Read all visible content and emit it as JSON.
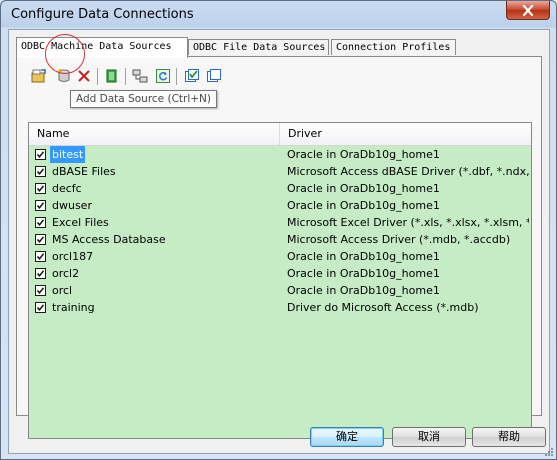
{
  "window": {
    "title": "Configure Data Connections"
  },
  "tabs": [
    {
      "label": "ODBC Machine Data Sources",
      "active": true
    },
    {
      "label": "ODBC File Data Sources",
      "active": false
    },
    {
      "label": "Connection Profiles",
      "active": false
    }
  ],
  "toolbar": {
    "buttons": [
      "open-icon",
      "add-data-source-icon",
      "delete-icon",
      "configure-icon",
      "test-connection-icon",
      "refresh-icon",
      "check-all-icon",
      "uncheck-all-icon"
    ]
  },
  "tooltip": "Add Data Source (Ctrl+N)",
  "list": {
    "columns": [
      "Name",
      "Driver"
    ],
    "rows": [
      {
        "name": "bitest",
        "driver": "Oracle in OraDb10g_home1",
        "checked": true,
        "selected": true
      },
      {
        "name": "dBASE Files",
        "driver": "Microsoft Access dBASE Driver (*.dbf, *.ndx, *.m...",
        "checked": true,
        "selected": false
      },
      {
        "name": "decfc",
        "driver": "Oracle in OraDb10g_home1",
        "checked": true,
        "selected": false
      },
      {
        "name": "dwuser",
        "driver": "Oracle in OraDb10g_home1",
        "checked": true,
        "selected": false
      },
      {
        "name": "Excel Files",
        "driver": "Microsoft Excel Driver (*.xls, *.xlsx, *.xlsm, *.xlsb)",
        "checked": true,
        "selected": false
      },
      {
        "name": "MS Access Database",
        "driver": "Microsoft Access Driver (*.mdb, *.accdb)",
        "checked": true,
        "selected": false
      },
      {
        "name": "orcl187",
        "driver": "Oracle in OraDb10g_home1",
        "checked": true,
        "selected": false
      },
      {
        "name": "orcl2",
        "driver": "Oracle in OraDb10g_home1",
        "checked": true,
        "selected": false
      },
      {
        "name": "orcl",
        "driver": "Oracle in OraDb10g_home1",
        "checked": true,
        "selected": false
      },
      {
        "name": "training",
        "driver": "Driver do Microsoft Access (*.mdb)",
        "checked": true,
        "selected": false
      }
    ]
  },
  "buttons": {
    "ok": "确定",
    "cancel": "取消",
    "help": "帮助"
  },
  "colors": {
    "list_background": "#c6ecc6",
    "selection": "#3399ff",
    "highlight_circle": "#d2322d"
  }
}
